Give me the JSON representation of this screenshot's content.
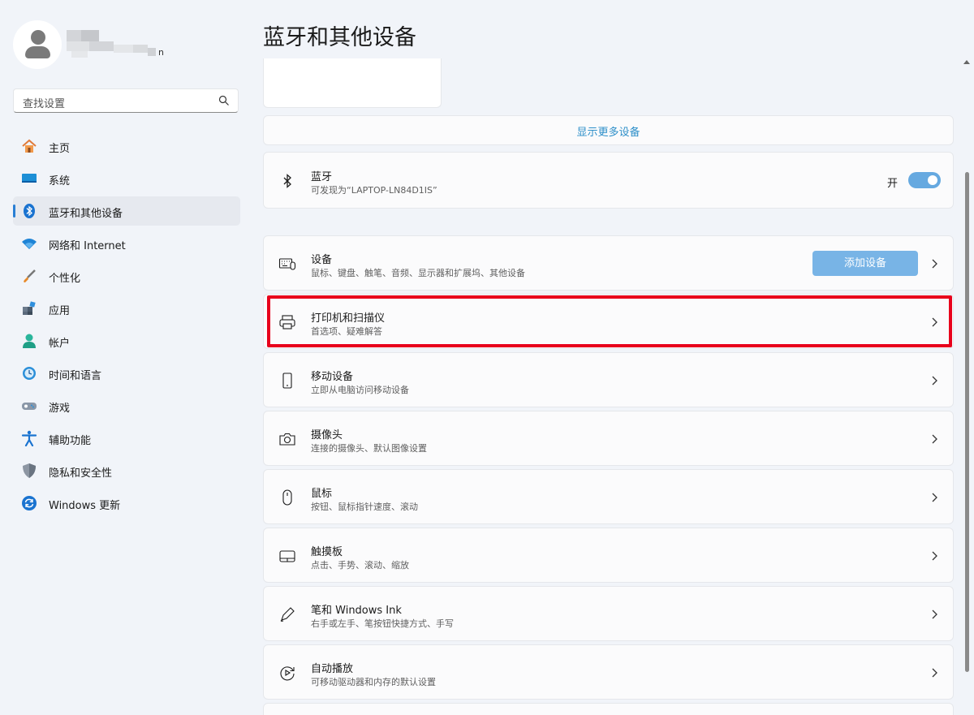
{
  "user": {
    "name_suffix": "n"
  },
  "search": {
    "placeholder": "查找设置"
  },
  "nav": {
    "items": [
      {
        "label": "主页",
        "icon": "home-icon"
      },
      {
        "label": "系统",
        "icon": "system-icon"
      },
      {
        "label": "蓝牙和其他设备",
        "icon": "bluetooth-icon",
        "active": true
      },
      {
        "label": "网络和 Internet",
        "icon": "wifi-icon"
      },
      {
        "label": "个性化",
        "icon": "brush-icon"
      },
      {
        "label": "应用",
        "icon": "apps-icon"
      },
      {
        "label": "帐户",
        "icon": "account-icon"
      },
      {
        "label": "时间和语言",
        "icon": "time-language-icon"
      },
      {
        "label": "游戏",
        "icon": "gamepad-icon"
      },
      {
        "label": "辅助功能",
        "icon": "accessibility-icon"
      },
      {
        "label": "隐私和安全性",
        "icon": "shield-icon"
      },
      {
        "label": "Windows 更新",
        "icon": "update-icon"
      }
    ]
  },
  "page": {
    "title": "蓝牙和其他设备"
  },
  "show_more": {
    "label": "显示更多设备"
  },
  "bluetooth": {
    "title": "蓝牙",
    "subtitle": "可发现为“LAPTOP-LN84D1IS”",
    "toggle_label": "开",
    "toggle_on": true
  },
  "devices": {
    "title": "设备",
    "subtitle": "鼠标、键盘、触笔、音频、显示器和扩展坞、其他设备",
    "add_button": "添加设备"
  },
  "settings_rows": [
    {
      "title": "打印机和扫描仪",
      "subtitle": "首选项、疑难解答",
      "icon": "printer-icon"
    },
    {
      "title": "移动设备",
      "subtitle": "立即从电脑访问移动设备",
      "icon": "phone-icon"
    },
    {
      "title": "摄像头",
      "subtitle": "连接的摄像头、默认图像设置",
      "icon": "camera-icon"
    },
    {
      "title": "鼠标",
      "subtitle": "按钮、鼠标指针速度、滚动",
      "icon": "mouse-icon"
    },
    {
      "title": "触摸板",
      "subtitle": "点击、手势、滚动、缩放",
      "icon": "touchpad-icon"
    },
    {
      "title": "笔和 Windows Ink",
      "subtitle": "右手或左手、笔按钮快捷方式、手写",
      "icon": "pen-icon"
    },
    {
      "title": "自动播放",
      "subtitle": "可移动驱动器和内存的默认设置",
      "icon": "autoplay-icon"
    }
  ],
  "colors": {
    "accent": "#2a7fd4",
    "highlight": "#e8001c",
    "toggle": "#66a9e0"
  }
}
